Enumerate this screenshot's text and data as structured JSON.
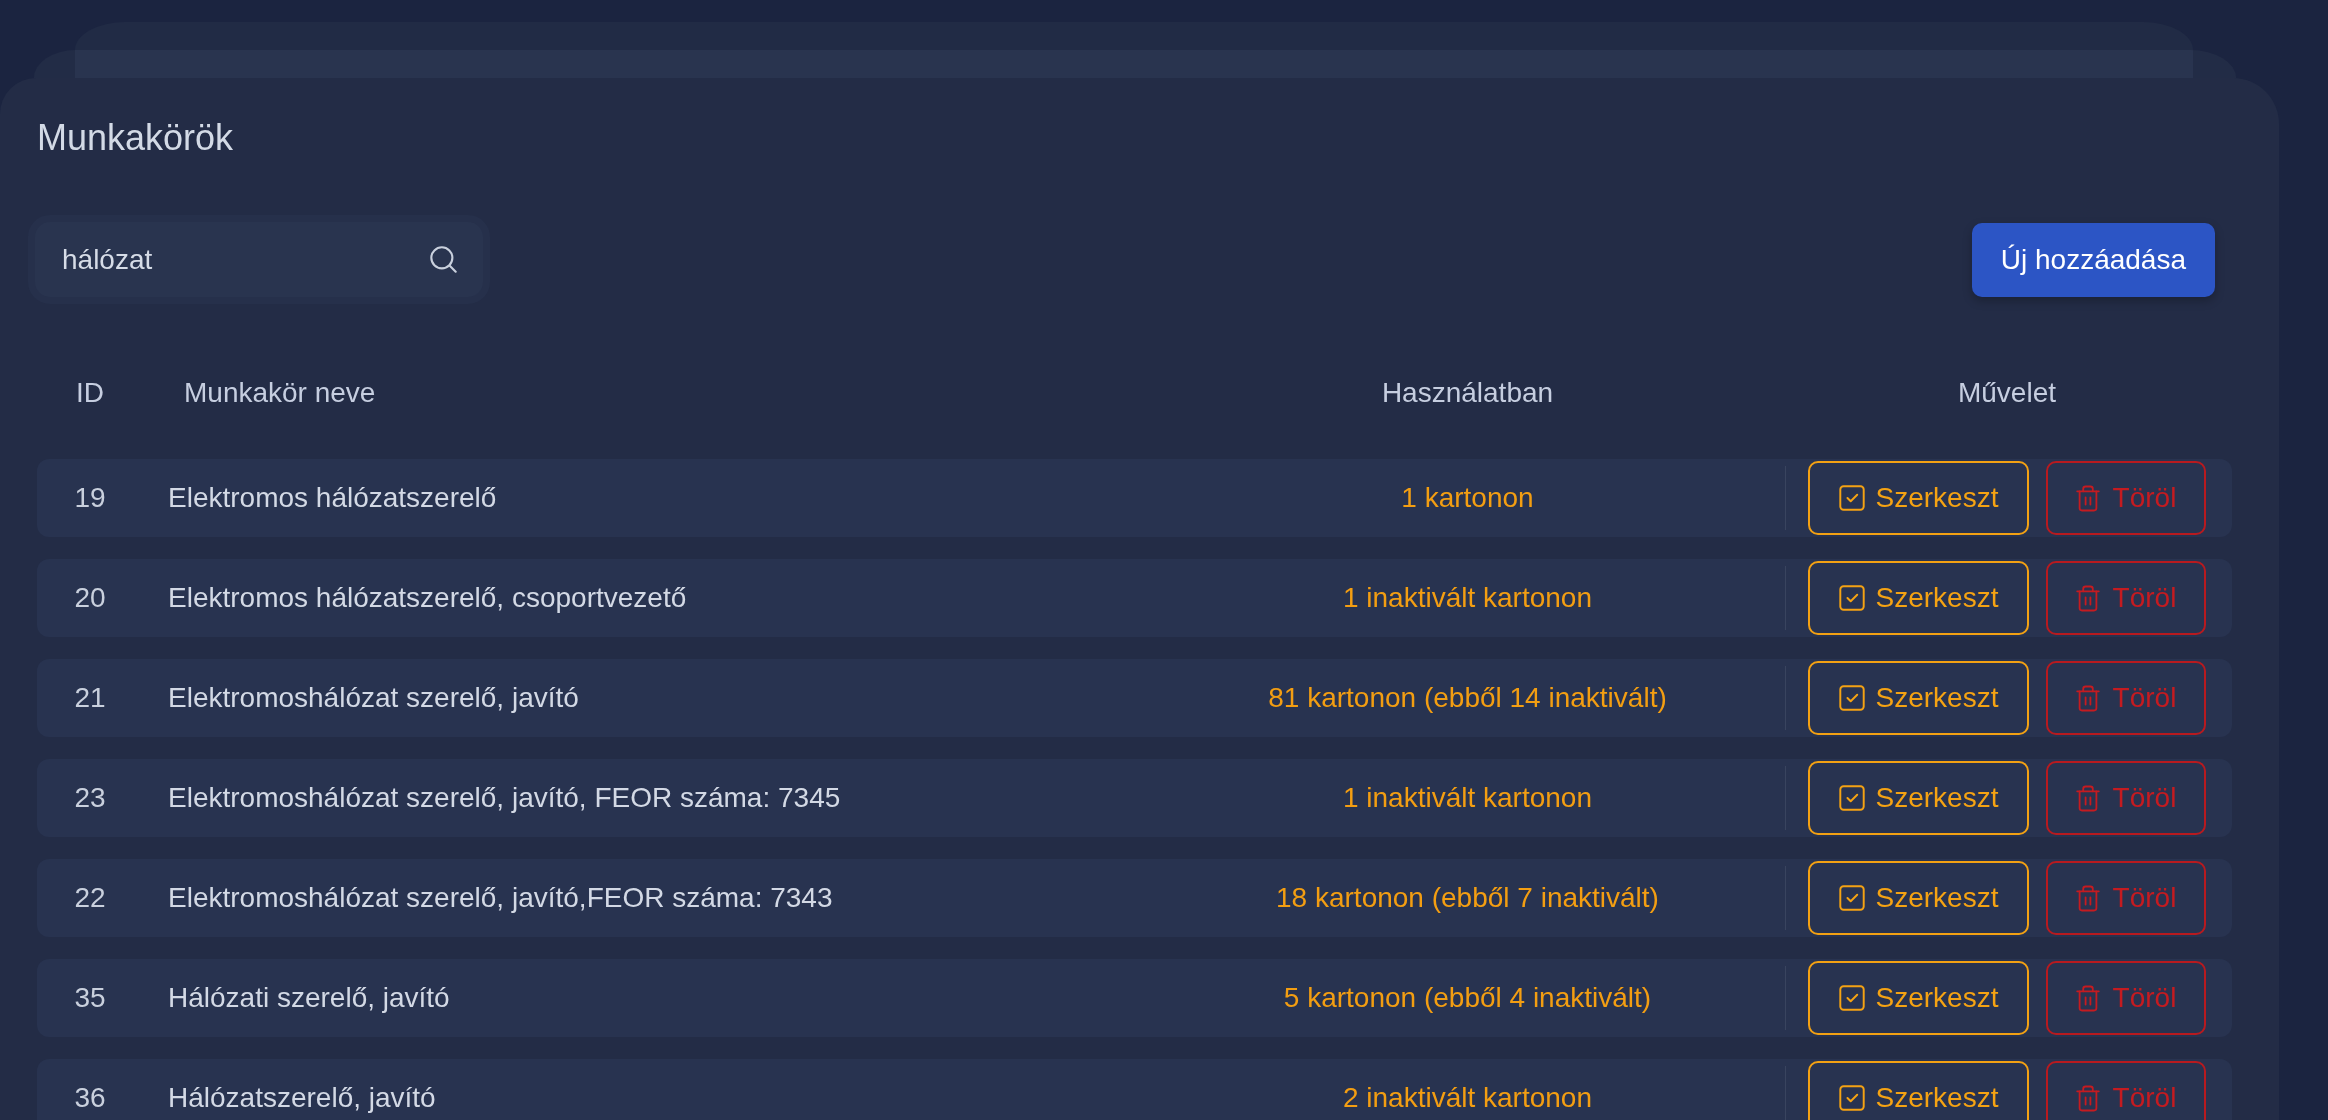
{
  "page_title": "Munkakörök",
  "search": {
    "value": "hálózat"
  },
  "add_button": {
    "label": "Új hozzáadása"
  },
  "table": {
    "columns": [
      "ID",
      "Munkakör neve",
      "Használatban",
      "Művelet"
    ],
    "rows": [
      {
        "id": "19",
        "name": "Elektromos hálózatszerelő",
        "usage": "1 kartonon",
        "actions": [
          {
            "kind": "edit",
            "label": "Szerkeszt"
          },
          {
            "kind": "delete",
            "label": "Töröl"
          }
        ]
      },
      {
        "id": "20",
        "name": "Elektromos hálózatszerelő, csoportvezető",
        "usage": "1 inaktivált kartonon",
        "actions": [
          {
            "kind": "edit",
            "label": "Szerkeszt"
          },
          {
            "kind": "delete",
            "label": "Töröl"
          }
        ]
      },
      {
        "id": "21",
        "name": "Elektromoshálózat szerelő, javító",
        "usage": "81 kartonon (ebből 14 inaktivált)",
        "actions": [
          {
            "kind": "edit",
            "label": "Szerkeszt"
          },
          {
            "kind": "delete",
            "label": "Töröl"
          }
        ]
      },
      {
        "id": "23",
        "name": "Elektromoshálózat szerelő, javító, FEOR száma: 7345",
        "usage": "1 inaktivált kartonon",
        "actions": [
          {
            "kind": "edit",
            "label": "Szerkeszt"
          },
          {
            "kind": "delete",
            "label": "Töröl"
          }
        ]
      },
      {
        "id": "22",
        "name": "Elektromoshálózat szerelő, javító,FEOR száma: 7343",
        "usage": "18 kartonon (ebből 7 inaktivált)",
        "actions": [
          {
            "kind": "edit",
            "label": "Szerkeszt"
          },
          {
            "kind": "delete",
            "label": "Töröl"
          }
        ]
      },
      {
        "id": "35",
        "name": "Hálózati szerelő, javító",
        "usage": "5 kartonon (ebből 4 inaktivált)",
        "actions": [
          {
            "kind": "edit",
            "label": "Szerkeszt"
          },
          {
            "kind": "delete",
            "label": "Töröl"
          }
        ]
      },
      {
        "id": "36",
        "name": "Hálózatszerelő, javító",
        "usage": "2 inaktivált kartonon",
        "actions": [
          {
            "kind": "edit",
            "label": "Szerkeszt"
          },
          {
            "kind": "delete",
            "label": "Töröl"
          }
        ]
      }
    ]
  }
}
